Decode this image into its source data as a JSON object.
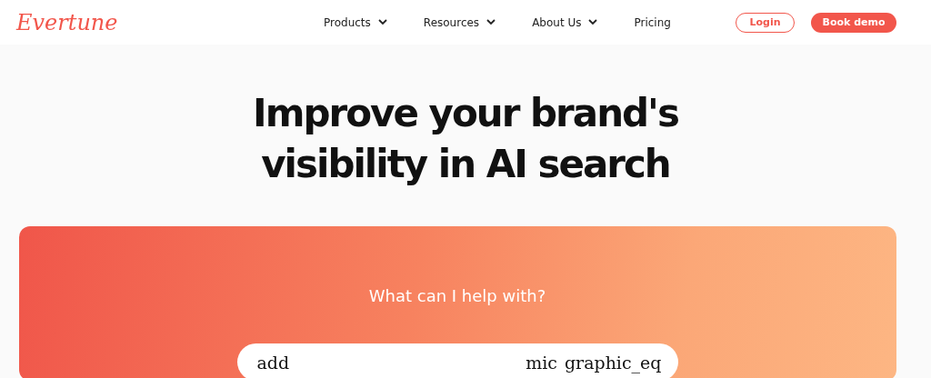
{
  "logo": "Evertune",
  "nav": [
    {
      "label": "Products",
      "dropdown": true
    },
    {
      "label": "Resources",
      "dropdown": true
    },
    {
      "label": "About Us",
      "dropdown": true
    },
    {
      "label": "Pricing",
      "dropdown": false
    }
  ],
  "actions": {
    "login": "Login",
    "book": "Book demo"
  },
  "headline": [
    "Improve your brand's",
    "visibility in AI search"
  ],
  "prompt": {
    "title": "What can I help with?",
    "add": "add",
    "mic": "mic",
    "wave": "graphic_eq"
  }
}
